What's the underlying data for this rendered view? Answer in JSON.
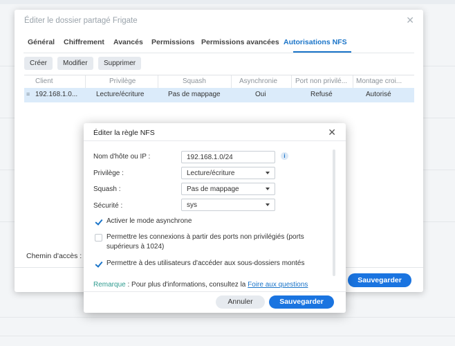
{
  "window": {
    "title": "Éditer le dossier partagé Frigate",
    "tabs": [
      {
        "label": "Général"
      },
      {
        "label": "Chiffrement"
      },
      {
        "label": "Avancés"
      },
      {
        "label": "Permissions"
      },
      {
        "label": "Permissions avancées"
      },
      {
        "label": "Autorisations NFS",
        "active": true
      }
    ],
    "toolbar": {
      "create": "Créer",
      "edit": "Modifier",
      "delete": "Supprimer"
    },
    "table": {
      "headers": [
        "Client",
        "Privilège",
        "Squash",
        "Asynchronie",
        "Port non privilé...",
        "Montage croi..."
      ],
      "rows": [
        [
          "192.168.1.0...",
          "Lecture/écriture",
          "Pas de mappage",
          "Oui",
          "Refusé",
          "Autorisé"
        ]
      ]
    },
    "path_label": "Chemin d'accès : /",
    "save": "Sauvegarder"
  },
  "dialog": {
    "title": "Éditer la règle NFS",
    "host_label": "Nom d'hôte ou IP :",
    "host_value": "192.168.1.0/24",
    "privilege_label": "Privilège :",
    "privilege_value": "Lecture/écriture",
    "squash_label": "Squash :",
    "squash_value": "Pas de mappage",
    "security_label": "Sécurité :",
    "security_value": "sys",
    "options": [
      {
        "label": "Activer le mode asynchrone",
        "checked": true
      },
      {
        "label": "Permettre les connexions à partir des ports non privilégiés (ports supérieurs à 1024)",
        "checked": false
      },
      {
        "label": "Permettre à des utilisateurs d'accéder aux sous-dossiers montés",
        "checked": true
      }
    ],
    "remark_key": "Remarque",
    "remark_text": " : Pour plus d'informations, consultez la ",
    "remark_link": "Foire aux questions",
    "cancel": "Annuler",
    "save": "Sauvegarder"
  },
  "colors": {
    "accent": "#1a74e0",
    "selected_row": "#dbebfa",
    "remark": "#2e9b8f"
  }
}
